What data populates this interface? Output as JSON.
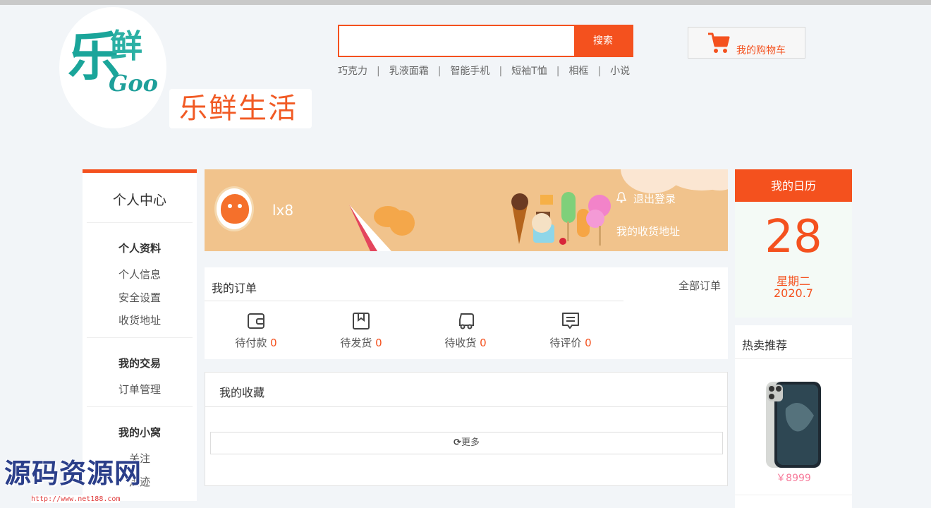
{
  "header": {
    "logo": {
      "le": "乐",
      "xian": "鲜",
      "goo": "Goo"
    },
    "brand_name": "乐鲜生活",
    "search": {
      "value": "",
      "placeholder": "",
      "button_label": "搜索"
    },
    "hotwords": [
      "巧克力",
      "乳液面霜",
      "智能手机",
      "短袖T恤",
      "相框",
      "小说"
    ],
    "cart_label": "我的购物车"
  },
  "sidebar": {
    "title": "个人中心",
    "sections": [
      {
        "heading": "个人资料",
        "items": [
          "个人信息",
          "安全设置",
          "收货地址"
        ]
      },
      {
        "heading": "我的交易",
        "items": [
          "订单管理"
        ]
      },
      {
        "heading": "我的小窝",
        "items": [
          "关注",
          "足迹"
        ]
      }
    ]
  },
  "profile": {
    "username": "lx8",
    "logout_label": "退出登录",
    "address_label": "我的收货地址"
  },
  "orders": {
    "title": "我的订单",
    "all_label": "全部订单",
    "statuses": [
      {
        "label": "待付款",
        "count": "0",
        "icon": "wallet-icon"
      },
      {
        "label": "待发货",
        "count": "0",
        "icon": "box-icon"
      },
      {
        "label": "待收货",
        "count": "0",
        "icon": "truck-icon"
      },
      {
        "label": "待评价",
        "count": "0",
        "icon": "comment-icon"
      }
    ]
  },
  "favorites": {
    "title": "我的收藏",
    "more_label": "更多"
  },
  "calendar": {
    "title": "我的日历",
    "day": "28",
    "weekday": "星期二",
    "date": "2020.7"
  },
  "hot": {
    "title": "热卖推荐",
    "items": [
      {
        "price": "￥8999",
        "image": "phone-image"
      }
    ]
  },
  "watermark": {
    "text": "源码资源网",
    "url": "http://www.net188.com"
  },
  "colors": {
    "accent": "#f4511e",
    "teal": "#1aa59a",
    "banner": "#f1c38c"
  }
}
